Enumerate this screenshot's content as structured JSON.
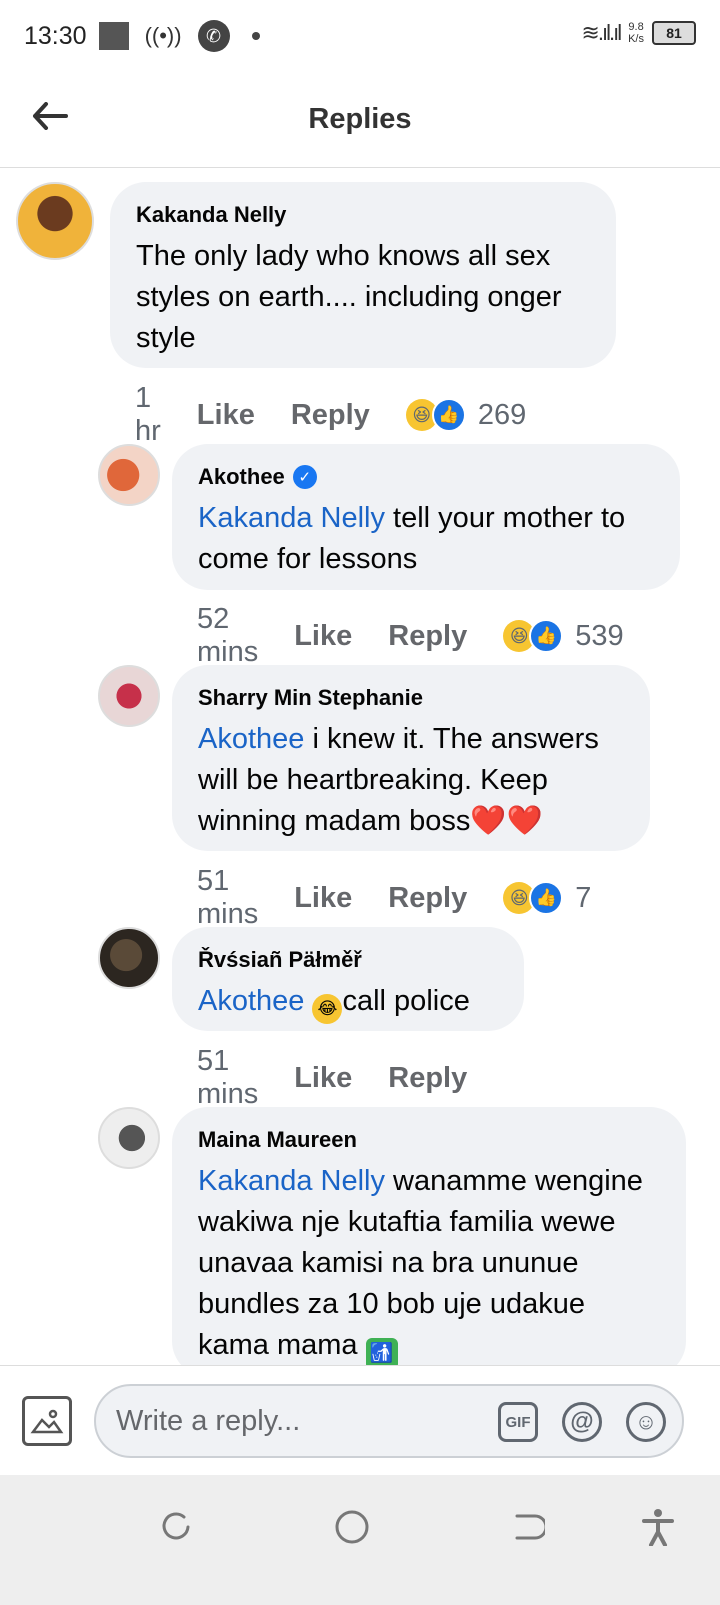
{
  "status_bar": {
    "time": "13:30",
    "speed_value": "9.8",
    "speed_unit": "K/s",
    "battery": "81"
  },
  "header": {
    "title": "Replies"
  },
  "comments": [
    {
      "author": "Kakanda Nelly",
      "verified": false,
      "mention": "",
      "text": "The only lady who knows all sex styles on earth.... including onger style",
      "time": "1 hr",
      "like": "Like",
      "reply": "Reply",
      "reaction_count": "269"
    },
    {
      "author": "Akothee",
      "verified": true,
      "mention": "Kakanda Nelly",
      "text": " tell your mother to come for lessons",
      "time": "52 mins",
      "like": "Like",
      "reply": "Reply",
      "reaction_count": "539"
    },
    {
      "author": "Sharry Min Stephanie",
      "verified": false,
      "mention": "Akothee",
      "text": " i knew it. The answers will be heartbreaking. Keep winning madam boss❤️❤️",
      "time": "51 mins",
      "like": "Like",
      "reply": "Reply",
      "reaction_count": "7"
    },
    {
      "author": "Řvśsiañ Päłměř",
      "verified": false,
      "mention": "Akothee",
      "text": "call police",
      "time": "51 mins",
      "like": "Like",
      "reply": "Reply",
      "reaction_count": ""
    },
    {
      "author": "Maina Maureen",
      "verified": false,
      "mention": "Kakanda Nelly",
      "text": " wanamme wengine wakiwa nje kutaftia familia wewe unavaa kamisi na bra ununue bundles za 10 bob uje udakue kama mama",
      "time": "",
      "like": "",
      "reply": "",
      "reaction_count": ""
    }
  ],
  "composer": {
    "placeholder": "Write a reply...",
    "gif_label": "GIF",
    "at_label": "@"
  },
  "icons": {
    "back": "back-arrow-icon",
    "photo": "photo-icon",
    "emoji": "smiley-icon"
  },
  "colors": {
    "mention": "#1a64c7",
    "bubble": "#f0f2f5",
    "like_reaction": "#1b74e4"
  }
}
